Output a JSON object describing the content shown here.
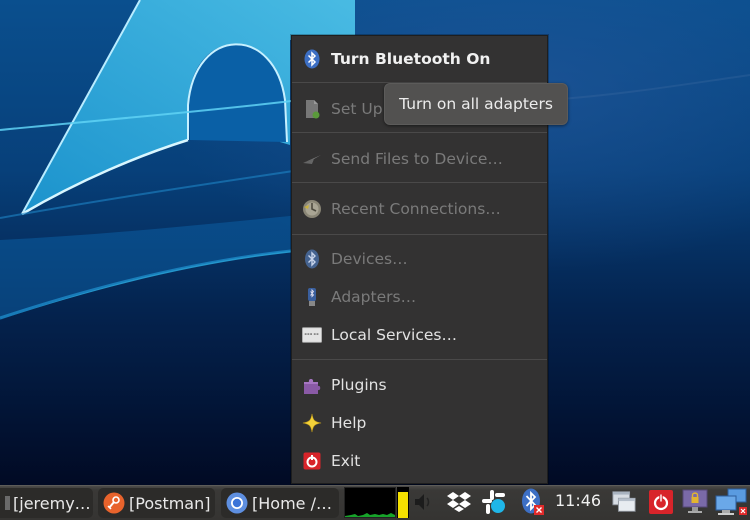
{
  "menu": {
    "items": [
      {
        "id": "turn-bluetooth-on",
        "label": "Turn Bluetooth On",
        "icon": "bluetooth-icon",
        "enabled": true,
        "bold": true
      },
      {
        "id": "set-up-device",
        "label": "Set Up New Device…",
        "visible_label": "Set Up",
        "icon": "new-device-icon",
        "enabled": false
      },
      {
        "id": "send-files",
        "label": "Send Files to Device…",
        "icon": "send-files-icon",
        "enabled": false
      },
      {
        "id": "recent-connections",
        "label": "Recent Connections…",
        "icon": "recent-connections-icon",
        "enabled": false
      },
      {
        "id": "devices",
        "label": "Devices…",
        "icon": "bluetooth-icon",
        "enabled": false
      },
      {
        "id": "adapters",
        "label": "Adapters…",
        "icon": "adapter-icon",
        "enabled": false
      },
      {
        "id": "local-services",
        "label": "Local Services…",
        "icon": "local-services-icon",
        "enabled": true
      },
      {
        "id": "plugins",
        "label": "Plugins",
        "icon": "plugin-icon",
        "enabled": true
      },
      {
        "id": "help",
        "label": "Help",
        "icon": "help-star-icon",
        "enabled": true
      },
      {
        "id": "exit",
        "label": "Exit",
        "icon": "exit-icon",
        "enabled": true
      }
    ]
  },
  "tooltip": {
    "text": "Turn on all adapters"
  },
  "taskbar": {
    "tasks": [
      {
        "label": "[jeremy…",
        "icon": "terminal-icon"
      },
      {
        "label": "[Postman]",
        "icon": "postman-icon"
      },
      {
        "label": "[Home /…",
        "icon": "chromium-icon"
      }
    ],
    "memory_usage_fraction": 0.85,
    "tray": [
      {
        "name": "volume-icon"
      },
      {
        "name": "dropbox-icon"
      },
      {
        "name": "slack-icon"
      },
      {
        "name": "bluetooth-disabled-icon"
      },
      {
        "name": "show-windows-icon"
      },
      {
        "name": "power-icon"
      },
      {
        "name": "lock-screen-icon"
      },
      {
        "name": "network-disconnected-icon"
      }
    ],
    "clock": "11:46"
  },
  "colors": {
    "menu_bg": "#333232",
    "menu_text": "#e2e2e2",
    "menu_text_disabled": "#7a7a7a",
    "tooltip_bg": "#525150",
    "bluetooth_blue": "#3d6fc4",
    "memory_bar": "#f4e000",
    "exit_red": "#d8242a"
  }
}
